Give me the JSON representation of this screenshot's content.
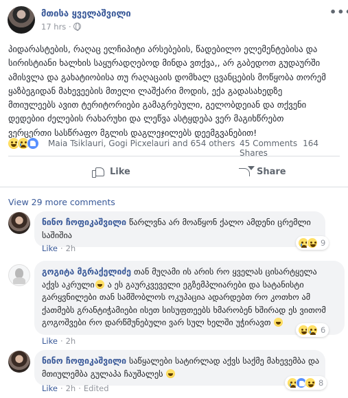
{
  "header": {
    "author": "მთისა ყველაშვილი",
    "time": "17 hrs ·",
    "more_icon": "ellipsis-icon",
    "audience_icon": "globe-icon"
  },
  "post": {
    "lines": [
      "პიდარასტების, რაღაც ელჩიპიტი არსებების, წადებილო ელემენტებისა და",
      "სირისტიანი ხალხის საყურადღებოდ მინდა ვთქვა,, არ გაბედოთ გუდაურში",
      "ამისვლა და გახატიობისა თუ რაღაცაის დომხალ ცვანცების მოწყობა თორემ",
      "ყაზბეგიდან მახევეების მთელი ლაშქარი მოდის, ექა გადასახედზე",
      "მთიულეებს ავით ტერიტორიები გამაგრებული, გელობდეიან და თქვენი",
      "დედებიი ძელების რახარუხი და ლეწვა ასტყდება ვერ მაგიხწრებთ",
      "ვერცერთი სასწრაფო მგლის დაგლეჯილებს დეემგვანებით!"
    ]
  },
  "reactions": {
    "names": "Maia Tsiklauri, Gogi Picxelauri and 654 others",
    "comments": "45 Comments",
    "shares": "164 Shares",
    "colors": {
      "haha": "#f7b125",
      "sad": "#f7b125",
      "like": "#5890ff"
    }
  },
  "actions": {
    "like": "Like",
    "share": "Share"
  },
  "view_more": "View 29 more comments",
  "comments": [
    {
      "author": "ნინო ჩოფიკაშვილი",
      "lines": [
        "წარლვნა არ მოაწყონ ქალო ამდენი ცრემლი",
        "საშიშია"
      ],
      "like": "Like",
      "time": "2h",
      "reaction_count": "9"
    },
    {
      "author": "გოგიტა მგრაქელიძე",
      "lines": [
        "თან მუღამი ის არის რო ყველას ცისარტყელა",
        "აქვს აკრული",
        "ა ეს გაურკვეველი ეგზემპლიარები და სატანისტი",
        "გარყვნილები თან სამშობლოს ოკუპაცია ადარდებთ რო კოთხო ამ",
        "ქათმებს გრანტიჭამიები ისეთ სისუფთეებს ხმარობენ ხშირად ეს ვითომ",
        "გოგოშვები რო დარწმუნებული ვარ სულ ხელში უჭირავთ"
      ],
      "like": "Like",
      "time": "2h",
      "reaction_count": "6"
    },
    {
      "author": "ნინო ჩოფიკაშვილი",
      "lines": [
        "საწყალები სატირლად აქვს საქმე მახევემბა და",
        "მთიულემბა გულაპა ჩაუშალეს"
      ],
      "like": "Like",
      "time": "2h",
      "edited": "Edited",
      "reaction_count": "8"
    }
  ]
}
